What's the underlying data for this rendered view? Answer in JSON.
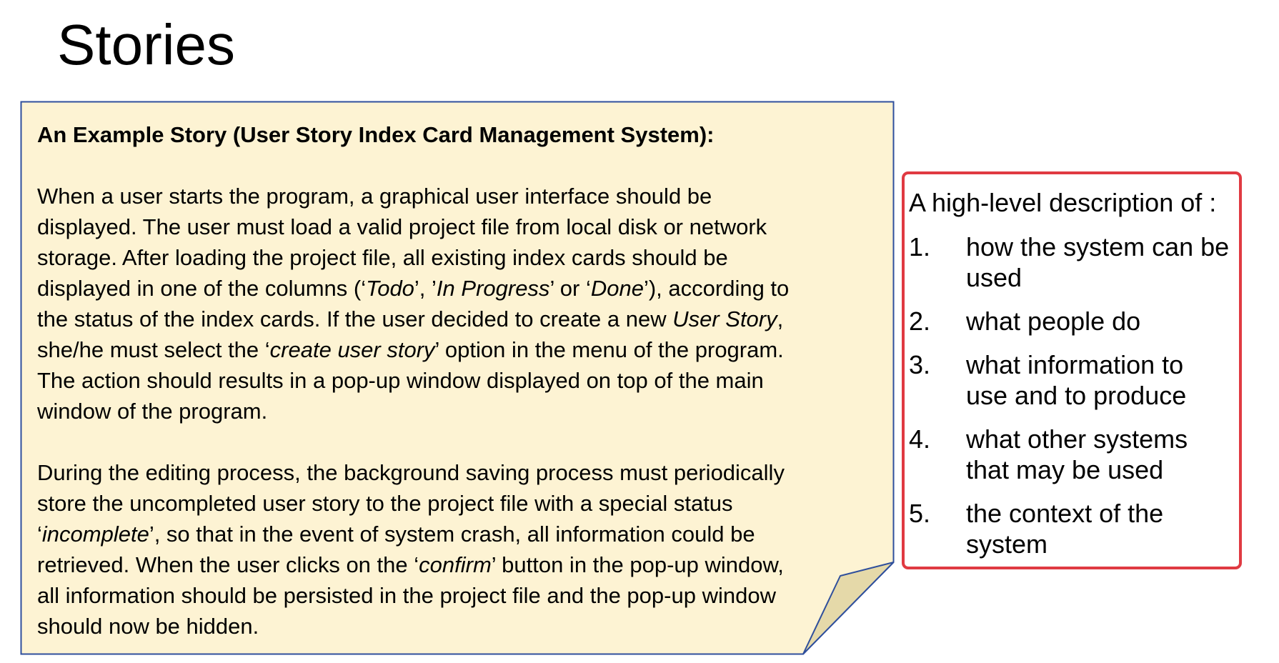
{
  "slide": {
    "title": "Stories"
  },
  "card": {
    "bg_color": "#fdf3d3",
    "border_color": "#2f4f9c",
    "heading": "An Example Story (User Story Index Card Management System):",
    "paragraphs": [
      [
        [
          {
            "t": "When a user starts the program, a graphical user interface should be"
          }
        ],
        [
          {
            "t": "displayed. The user must load a valid project file from local disk or network"
          }
        ],
        [
          {
            "t": "storage. After loading the project file, all existing index cards should be"
          }
        ],
        [
          {
            "t": "displayed in one of the columns (‘"
          },
          {
            "t": "Todo",
            "i": true
          },
          {
            "t": "’, ’"
          },
          {
            "t": "In Progress",
            "i": true
          },
          {
            "t": "’ or ‘"
          },
          {
            "t": "Done",
            "i": true
          },
          {
            "t": "’), according to"
          }
        ],
        [
          {
            "t": "the status of the index cards. If the user decided to create a new "
          },
          {
            "t": "User Story",
            "i": true
          },
          {
            "t": ","
          }
        ],
        [
          {
            "t": "she/he must select the ‘"
          },
          {
            "t": "create user story",
            "i": true
          },
          {
            "t": "’ option in the menu of the program."
          }
        ],
        [
          {
            "t": "The action should results in a pop-up window displayed on top of the main"
          }
        ],
        [
          {
            "t": "window of the program."
          }
        ]
      ],
      [
        [
          {
            "t": "During the editing process, the background saving process must periodically"
          }
        ],
        [
          {
            "t": "store the uncompleted user story to the project file with a special status"
          }
        ],
        [
          {
            "t": "‘"
          },
          {
            "t": "incomplete",
            "i": true
          },
          {
            "t": "’, so that in the event of system crash, all information could be"
          }
        ],
        [
          {
            "t": "retrieved.  When the user clicks on the ‘"
          },
          {
            "t": "confirm",
            "i": true
          },
          {
            "t": "’ button in the pop-up window,"
          }
        ],
        [
          {
            "t": "all information should be persisted in the project file and the pop-up window"
          }
        ],
        [
          {
            "t": "should now be hidden."
          }
        ]
      ]
    ]
  },
  "side_box": {
    "border_color": "#e03a42",
    "intro": "A high-level description of :",
    "items": [
      {
        "num": "1.",
        "lines": [
          "how the system can be",
          "used"
        ]
      },
      {
        "num": "2.",
        "lines": [
          "what people do"
        ]
      },
      {
        "num": "3.",
        "lines": [
          "what information to",
          "use and to produce"
        ]
      },
      {
        "num": "4.",
        "lines": [
          "what other systems",
          "that may be used"
        ]
      },
      {
        "num": "5.",
        "lines": [
          "the context of the",
          "system"
        ]
      }
    ]
  }
}
